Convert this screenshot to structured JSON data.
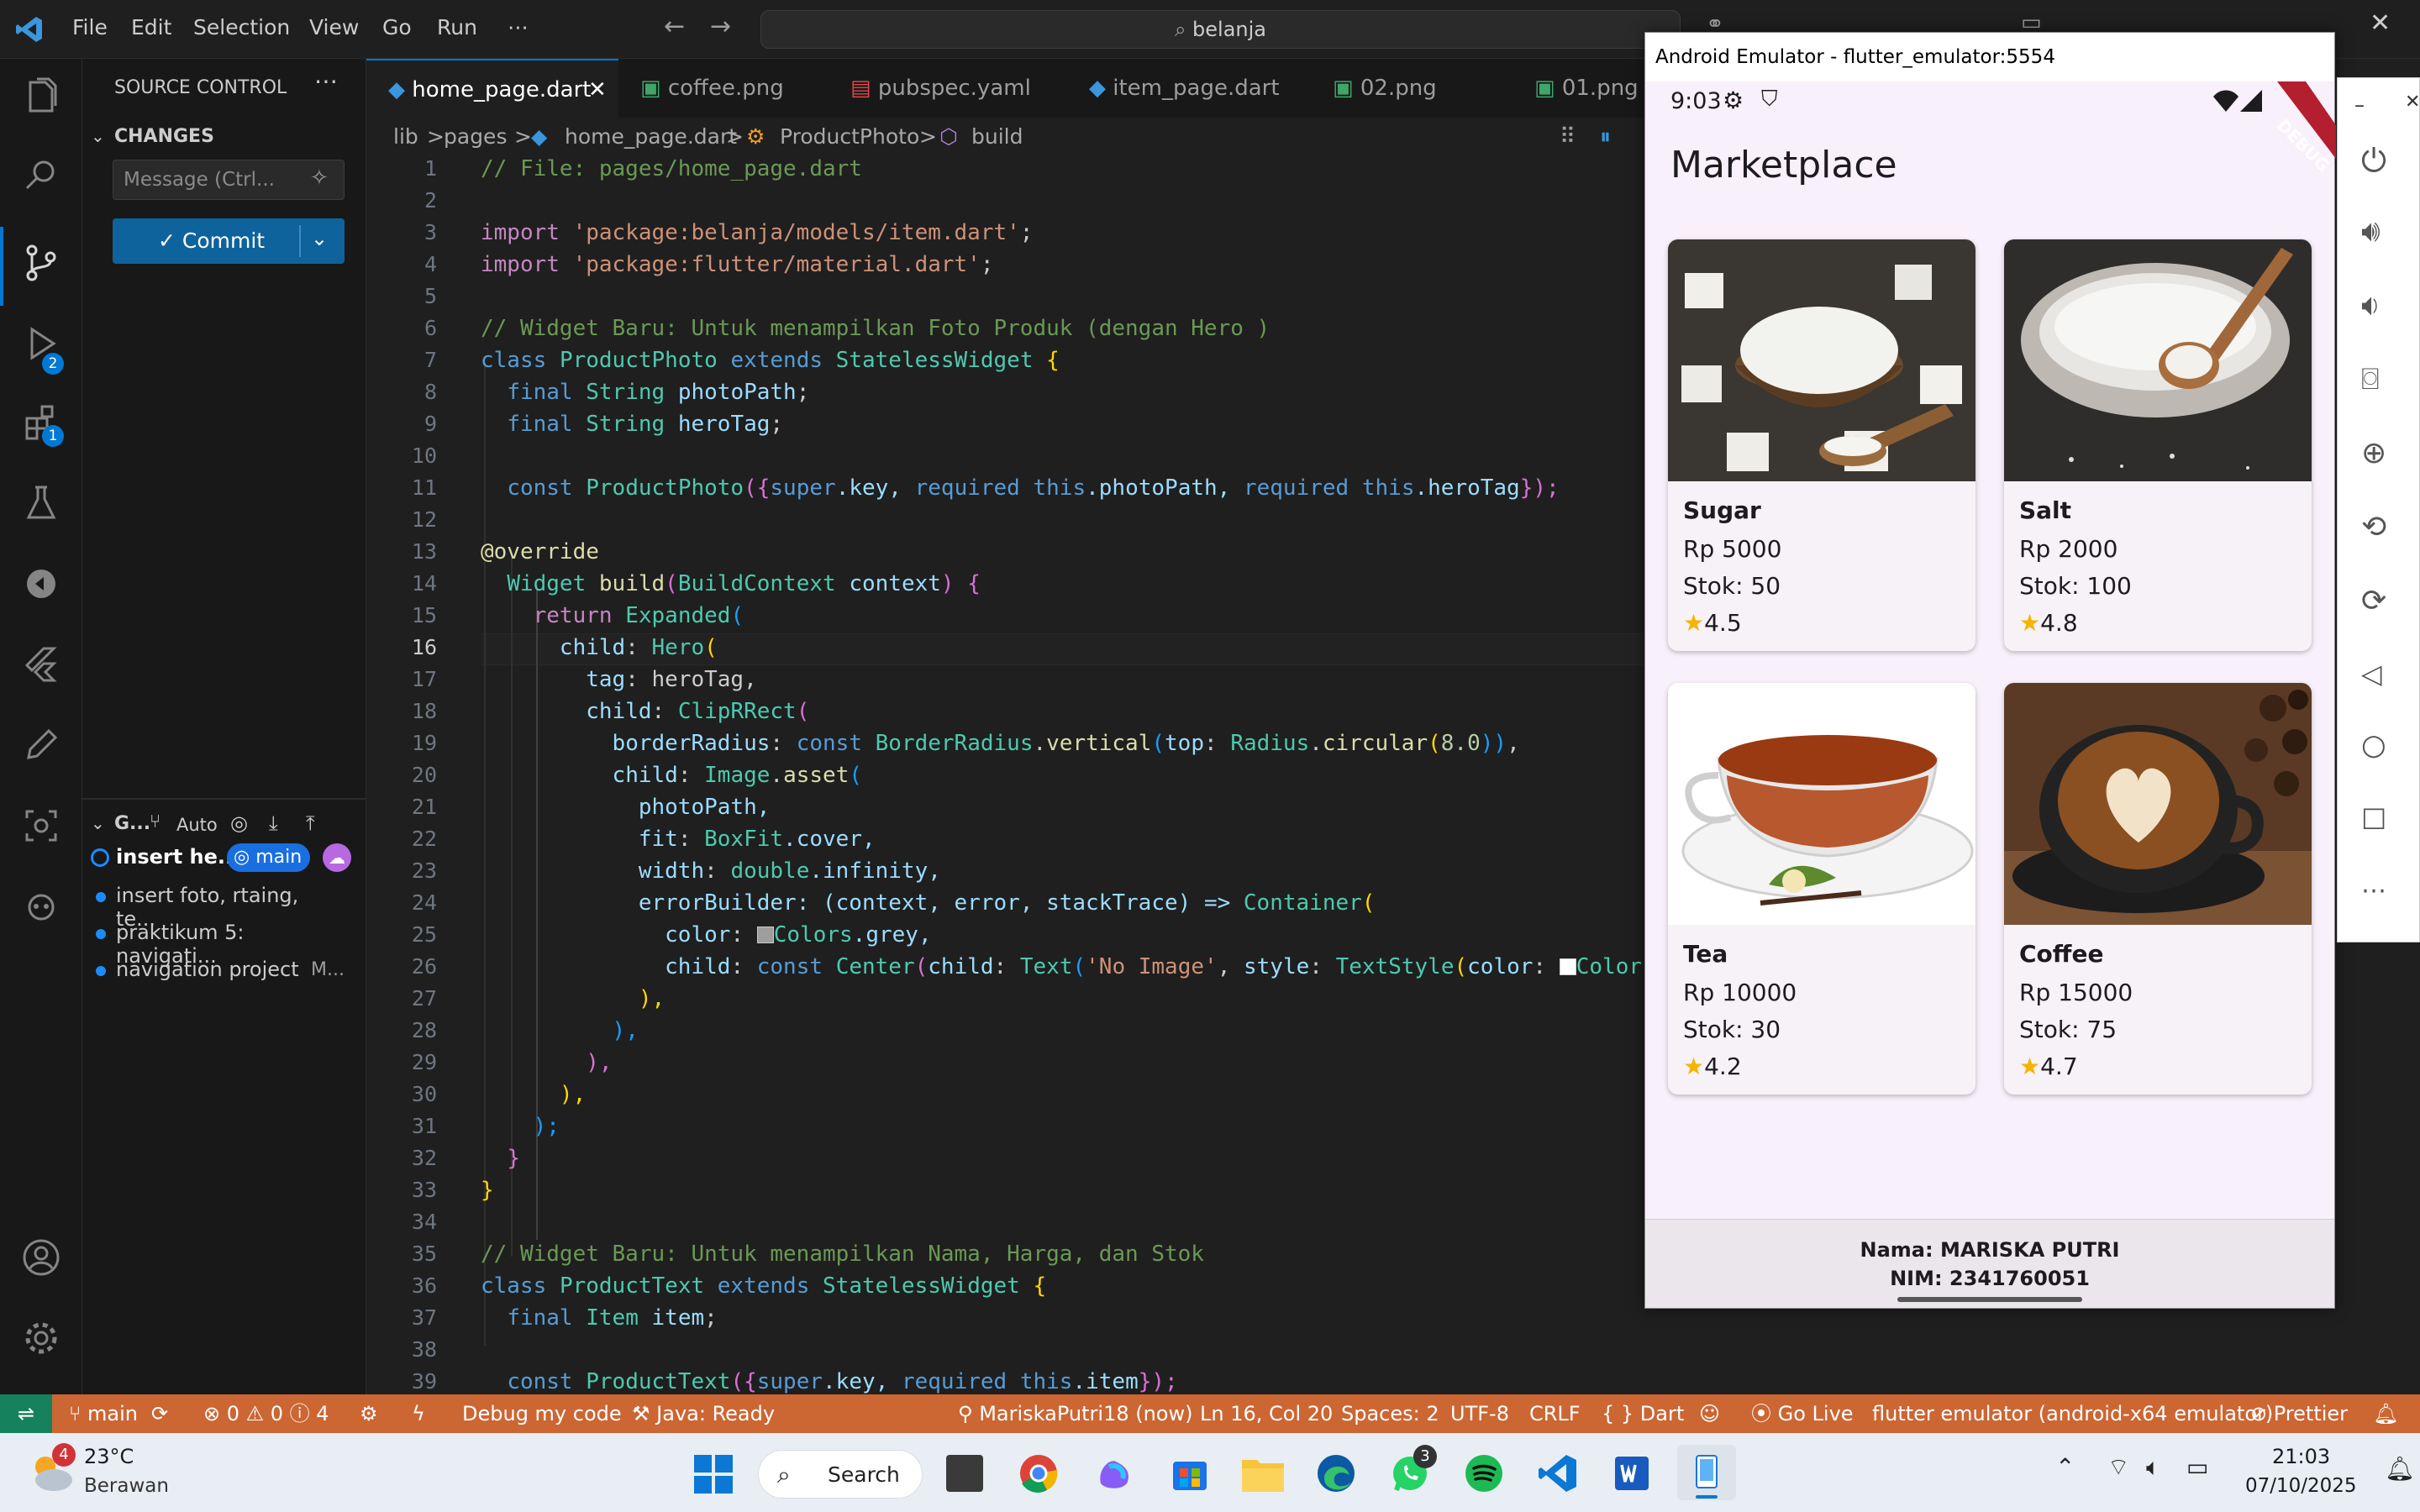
{
  "titlebar": {
    "menu": [
      "File",
      "Edit",
      "Selection",
      "View",
      "Go",
      "Run",
      "⋯"
    ],
    "search_text": "belanja"
  },
  "activity": {
    "run_badge": "2",
    "extensions_badge": "1"
  },
  "sidebar": {
    "title": "SOURCE CONTROL",
    "changes_label": "CHANGES",
    "message_placeholder": "Message (Ctrl...",
    "commit_label": "✓ Commit",
    "graph_label": "G...",
    "graph_auto": "Auto",
    "commits": [
      {
        "text": "insert he...",
        "branch": "main"
      },
      {
        "text": "insert foto, rtaing, te..."
      },
      {
        "text": "praktikum 5: navigati..."
      },
      {
        "text": "navigation project",
        "author": "M..."
      }
    ]
  },
  "tabs": [
    {
      "label": "home_page.dart",
      "active": true
    },
    {
      "label": "coffee.png"
    },
    {
      "label": "pubspec.yaml"
    },
    {
      "label": "item_page.dart"
    },
    {
      "label": "02.png"
    },
    {
      "label": "01.png"
    }
  ],
  "breadcrumb": [
    "lib",
    ">",
    "pages",
    ">",
    "home_page.dart",
    ">",
    "ProductPhoto",
    ">",
    "build"
  ],
  "code": {
    "line_numbers": [
      "1",
      "2",
      "3",
      "4",
      "5",
      "6",
      "7",
      "8",
      "9",
      "10",
      "11",
      "12",
      "13",
      "14",
      "15",
      "16",
      "17",
      "18",
      "19",
      "20",
      "21",
      "22",
      "23",
      "24",
      "25",
      "26",
      "27",
      "28",
      "29",
      "30",
      "31",
      "32",
      "33",
      "34",
      "35",
      "36",
      "37",
      "38",
      "39"
    ],
    "l1": "// File: pages/home_page.dart",
    "l3a": "import",
    "l3b": "'package:belanja/models/item.dart'",
    "l3c": ";",
    "l4a": "import",
    "l4b": "'package:flutter/material.dart'",
    "l4c": ";",
    "l6": "// Widget Baru: Untuk menampilkan Foto Produk (dengan Hero )",
    "l7a": "class",
    "l7b": "ProductPhoto",
    "l7c": "extends",
    "l7d": "StatelessWidget",
    "l7e": "{",
    "l8a": "final",
    "l8b": "String",
    "l8c": "photoPath",
    "l8d": ";",
    "l9a": "final",
    "l9b": "String",
    "l9c": "heroTag",
    "l9d": ";",
    "l11a": "const",
    "l11b": "ProductPhoto",
    "l11c": "({",
    "l11d": "super",
    "l11e": ".key, ",
    "l11f": "required",
    "l11g": "this",
    "l11h": ".photoPath, ",
    "l11i": "required",
    "l11j": "this",
    "l11k": ".heroTag",
    "l11l": "});",
    "l13": "@override",
    "l14a": "Widget",
    "l14b": "build",
    "l14c": "(",
    "l14d": "BuildContext",
    "l14e": "context",
    "l14f": ") {",
    "l15a": "return",
    "l15b": "Expanded",
    "l15c": "(",
    "l16a": "child",
    "l16b": ": ",
    "l16c": "Hero",
    "l16d": "(",
    "l17a": "tag",
    "l17b": ": heroTag,",
    "l18a": "child",
    "l18b": ": ",
    "l18c": "ClipRRect",
    "l18d": "(",
    "l19a": "borderRadius",
    "l19b": ": ",
    "l19c": "const",
    "l19d": "BorderRadius",
    "l19e": ".",
    "l19f": "vertical",
    "l19g": "(",
    "l19h": "top",
    "l19i": ": ",
    "l19j": "Radius",
    "l19k": ".",
    "l19l": "circular",
    "l19m": "(",
    "l19n": "8.0",
    "l19o": "))",
    "l19p": ",",
    "l20a": "child",
    "l20b": ": ",
    "l20c": "Image",
    "l20d": ".",
    "l20e": "asset",
    "l20f": "(",
    "l21": "photoPath,",
    "l22a": "fit",
    "l22b": ": ",
    "l22c": "BoxFit",
    "l22d": ".cover,",
    "l23a": "width",
    "l23b": ": ",
    "l23c": "double",
    "l23d": ".infinity,",
    "l24a": "errorBuilder",
    "l24b": ": (context, error, stackTrace) => ",
    "l24c": "Container",
    "l24d": "(",
    "l25a": "color",
    "l25b": ": ",
    "l25c": "Colors",
    "l25d": ".grey,",
    "l26a": "child",
    "l26b": ": ",
    "l26c": "const",
    "l26d": "Center",
    "l26e": "(",
    "l26f": "child",
    "l26g": ": ",
    "l26h": "Text",
    "l26i": "(",
    "l26j": "'No Image'",
    "l26k": ", ",
    "l26l": "style",
    "l26m": ": ",
    "l26n": "TextStyle",
    "l26o": "(",
    "l26p": "color",
    "l26q": ": ",
    "l26r": "Colors",
    "l27": "),",
    "l28": "),",
    "l29": "),",
    "l30": "),",
    "l31": ");",
    "l32": "}",
    "l33": "}",
    "l35": "// Widget Baru: Untuk menampilkan Nama, Harga, dan Stok",
    "l36a": "class",
    "l36b": "ProductText",
    "l36c": "extends",
    "l36d": "StatelessWidget",
    "l36e": "{",
    "l37a": "final",
    "l37b": "Item",
    "l37c": "item",
    "l37d": ";",
    "l39a": "const",
    "l39b": "ProductText",
    "l39c": "({",
    "l39d": "super",
    "l39e": ".key, ",
    "l39f": "required",
    "l39g": "this",
    "l39h": ".item",
    "l39i": "});"
  },
  "statusbar": {
    "branch": "main",
    "problems": "⊗ 0 ⚠ 0 ⓘ 4",
    "debug": "Debug my code",
    "java": "Java: Ready",
    "author": "MariskaPutri18 (now)",
    "position": "Ln 16, Col 20",
    "spaces": "Spaces: 2",
    "encoding": "UTF-8",
    "eol": "CRLF",
    "language": "{ } Dart",
    "golive": "Go Live",
    "device": "flutter emulator (android-x64 emulator)",
    "prettier": "Prettier"
  },
  "emulator": {
    "title": "Android Emulator - flutter_emulator:5554",
    "time": "9:03",
    "debug_banner": "DEBUG",
    "app_title": "Marketplace",
    "products": [
      {
        "name": "Sugar",
        "price": "Rp 5000",
        "stock": "Stok: 50",
        "rating": "4.5"
      },
      {
        "name": "Salt",
        "price": "Rp 2000",
        "stock": "Stok: 100",
        "rating": "4.8"
      },
      {
        "name": "Tea",
        "price": "Rp 10000",
        "stock": "Stok: 30",
        "rating": "4.2"
      },
      {
        "name": "Coffee",
        "price": "Rp 15000",
        "stock": "Stok: 75",
        "rating": "4.7"
      }
    ],
    "footer_name": "Nama: MARISKA PUTRI",
    "footer_nim": "NIM: 2341760051"
  },
  "taskbar": {
    "weather_badge": "4",
    "temperature": "23°C",
    "weather": "Berawan",
    "search_label": "Search",
    "whatsapp_badge": "3",
    "clock_time": "21:03",
    "clock_date": "07/10/2025"
  },
  "colors": {
    "statusbar": "#cc6633",
    "accent": "#0078d4",
    "editor_bg": "#1f1f1f"
  }
}
